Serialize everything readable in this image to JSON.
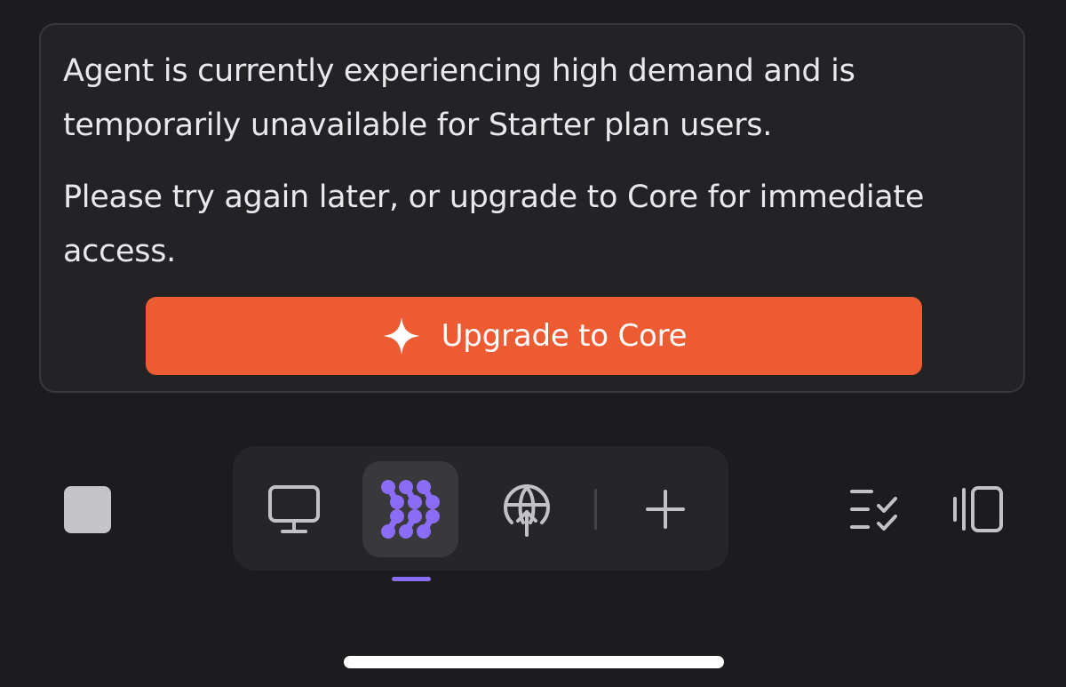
{
  "notice": {
    "paragraph_1": "Agent is currently experiencing high demand and is temporarily unavailable for Starter plan users.",
    "paragraph_2": "Please try again later, or upgrade to Core for immediate access.",
    "upgrade_button": {
      "label": "Upgrade to Core",
      "icon": "sparkle-icon",
      "color": "#ec5b32"
    }
  },
  "toolbar": {
    "stop_icon": "stop-square-icon",
    "modes": [
      {
        "name": "desktop",
        "icon": "monitor-icon",
        "active": false
      },
      {
        "name": "agent",
        "icon": "agent-dots-icon",
        "active": true
      },
      {
        "name": "web",
        "icon": "globe-upload-icon",
        "active": false
      }
    ],
    "add_icon": "plus-icon",
    "right_icons": [
      "checklist-icon",
      "side-panel-icon"
    ],
    "accent_color": "#8b6cf6"
  }
}
